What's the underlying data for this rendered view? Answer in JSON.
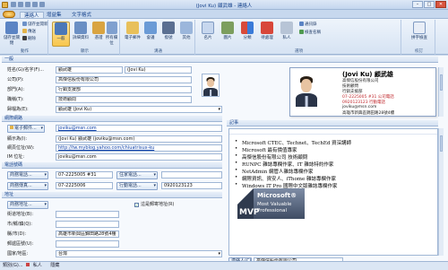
{
  "window": {
    "title": "(Jovi Ku) 顧武雄 - 連絡人",
    "minimize": "–",
    "maximize": "□",
    "close": "✕"
  },
  "tabs": [
    "連絡人",
    "增益集",
    "文字格式"
  ],
  "ribbon": {
    "actions": {
      "save_close": "儲存並關閉",
      "save_new": "儲存並開新",
      "send": "傳送",
      "delete": "刪除",
      "label": "動作"
    },
    "show": {
      "general": "一般",
      "details": "詳細資料",
      "certificates": "憑證",
      "all_fields": "所有欄位",
      "label": "顯示"
    },
    "communicate": {
      "email": "電子郵件",
      "meeting": "會議",
      "call": "撥號",
      "more": "其他",
      "label": "溝通"
    },
    "options": {
      "card": "名片",
      "picture": "圖片",
      "categorize": "分類",
      "follow_up": "待處理",
      "private": "私人",
      "address_book": "通訊錄",
      "check_names": "檢查名稱",
      "label": "選項"
    },
    "proofing": {
      "spelling": "拼字檢查",
      "label": "校訂"
    }
  },
  "sections": {
    "general": "一般",
    "internet": "網際網路",
    "phone": "電話號碼",
    "address": "地址",
    "notes": "記事"
  },
  "form": {
    "fullname_label": "姓名(G)/名字(F)...",
    "fullname_value": "顧武雄",
    "nickname_value": "(Jovi Ku)",
    "company_label": "公司(P):",
    "company_value": "高傑信股份有限公司",
    "department_label": "部門(A):",
    "department_value": "行銷支援部",
    "jobtitle_label": "職稱(T):",
    "jobtitle_value": "技術顧問",
    "fileas_label": "歸檔為(E):",
    "fileas_value": "顧武雄 (Jovi Ku)",
    "email_button": "電子郵件...",
    "email_value": "joviku@msn.com",
    "displayas_label": "顯示為(I):",
    "displayas_value": "(Jovi Ku) 顧武雄 (joviku@msn.com)",
    "webpage_label": "網頁位址(W):",
    "webpage_value": "http://tw.myblog.yahoo.com/chiuatrisux-ku",
    "im_label": "IM 位址:",
    "im_value": "joviku@msn.com",
    "phone1_button": "商務電話...",
    "phone1_value": "07-2225005 #31",
    "phone2_button": "住家電話...",
    "phone2_value": "",
    "phone3_button": "商務傳真...",
    "phone3_value": "07-2225006",
    "phone4_button": "行動電話...",
    "phone4_value": "0920123123",
    "address_button": "商務地址...",
    "mailing_checkbox": "這是郵寄地址(R)",
    "street_label": "街道地址(B):",
    "city_label": "市/鄉/鎮(Q):",
    "city_value": "",
    "state_label": "縣/市(D):",
    "state_value": "高雄市新興區錦田路28號4樓",
    "zip_label": "郵遞區號(U):",
    "zip_value": "",
    "country_label": "國家/地區:",
    "country_value": "台灣"
  },
  "card": {
    "name": "(Jovi Ku) 顧武雄",
    "company": "高傑信股份有限公司",
    "title": "技術顧問",
    "department": "行銷支援部",
    "phone_work": "07-2225005 #31 公司電話",
    "phone_mobile": "0920123123 行動電話",
    "email": "joviku@msn.com",
    "address": "高雄市新興區錦田路28號4樓"
  },
  "notes": {
    "items": [
      "Microsoft CTEC、Technet、TechEd 資深講師",
      "Microsoft 最有價值專家",
      "高傑信股份有限公司 技術顧問",
      "RUNPC 雜誌專欄作家、IT 雜誌特約作家",
      "NetAdmin 網管人雜誌專欄作家",
      "網際資訊、資安人、iThome 雜誌專欄作家",
      "Windows IT Pro 國際中文版雜誌專欄作家"
    ],
    "mvp_brand": "Microsoft®",
    "mvp_line1": "Most Valuable",
    "mvp_line2": "Professional",
    "mvp_badge": "MVP"
  },
  "footer": {
    "contacts_button": "連絡人(C)...",
    "contacts_value": "高傑信股份有限公司",
    "categories_label": "類別(G)...",
    "private_label": "私人",
    "private_value": "隱藏"
  },
  "colors": {
    "ribbon": "#d6e3f3",
    "accent": "#15428b",
    "card_red": "#c0282d"
  }
}
